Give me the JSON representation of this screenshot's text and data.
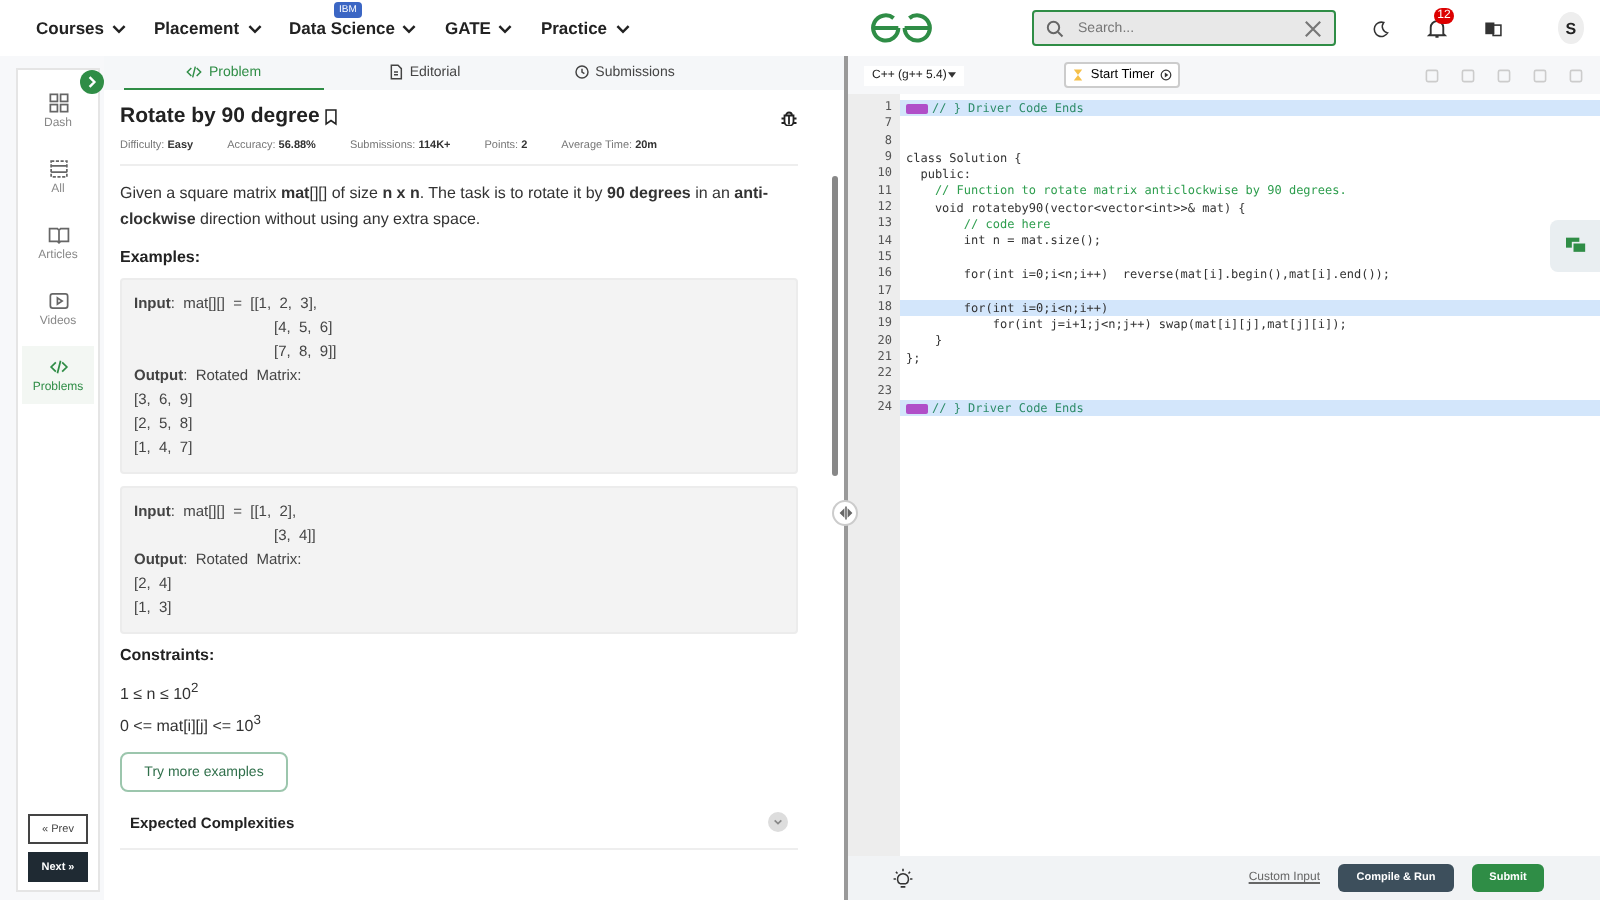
{
  "nav": {
    "items": [
      {
        "label": "Courses"
      },
      {
        "label": "Placement"
      },
      {
        "label": "Data Science",
        "badge": "IBM"
      },
      {
        "label": "GATE"
      },
      {
        "label": "Practice"
      }
    ],
    "search": {
      "placeholder": "Search..."
    },
    "notifications": "12",
    "avatar": "S"
  },
  "sidebar": {
    "items": [
      {
        "label": "Dash",
        "selected": false
      },
      {
        "label": "All",
        "selected": false
      },
      {
        "label": "Articles",
        "selected": false
      },
      {
        "label": "Videos",
        "selected": false
      },
      {
        "label": "Problems",
        "selected": true
      }
    ],
    "prev": "« Prev",
    "next": "Next »"
  },
  "tabs": [
    {
      "label": "Problem",
      "selected": true
    },
    {
      "label": "Editorial",
      "selected": false
    },
    {
      "label": "Submissions",
      "selected": false
    }
  ],
  "problem": {
    "title": "Rotate by 90 degree",
    "stats": [
      "Difficulty: **Easy**",
      "Accuracy: **56.88%**",
      "Submissions: **114K+**",
      "Points: **2**",
      "Average Time: **20m**"
    ],
    "statement": "Given a square matrix **mat**[][] of size **n x n**. The task is to rotate it by **90 degrees** in an **anti-clockwise** direction without using any extra space.",
    "examples_heading": "Examples:",
    "examples": [
      [
        {
          "text": "**Input**:  mat[][]  =  [[1,  2,  3],",
          "kind": "line"
        },
        {
          "text": "[4,  5,  6]",
          "kind": "continuation"
        },
        {
          "text": "[7,  8,  9]]",
          "kind": "continuation"
        },
        {
          "text": "**Output**:  Rotated  Matrix:",
          "kind": "line"
        },
        {
          "text": "[3,  6,  9]",
          "kind": "line"
        },
        {
          "text": "[2,  5,  8]",
          "kind": "line"
        },
        {
          "text": "[1,  4,  7]",
          "kind": "line"
        }
      ],
      [
        {
          "text": "**Input**:  mat[][]  =  [[1,  2],",
          "kind": "line"
        },
        {
          "text": "[3,  4]]",
          "kind": "continuation"
        },
        {
          "text": "**Output**:  Rotated  Matrix:",
          "kind": "line"
        },
        {
          "text": "[2,  4]",
          "kind": "line"
        },
        {
          "text": "[1,  3]",
          "kind": "line"
        }
      ]
    ],
    "constraints_heading": "Constraints:",
    "constraints": [
      "1 ≤ n ≤ 10$^{2}$",
      "0 <= mat[i][j] <= 10$^{3}$"
    ],
    "more_button": "Try more examples",
    "complexities": "Expected Complexities"
  },
  "editor": {
    "language": "C++ (g++ 5.4)",
    "timer": "Start Timer",
    "lines": [
      {
        "num": "1",
        "text": "// } Driver Code Ends",
        "kind": "driver",
        "highlighted": true
      },
      {
        "num": "7",
        "kind": "code",
        "highlighted": false
      },
      {
        "num": "8",
        "kind": "code",
        "highlighted": false
      },
      {
        "num": "9",
        "text": "class Solution {",
        "kind": "code",
        "highlighted": false
      },
      {
        "num": "10",
        "text": "  public:",
        "kind": "code",
        "highlighted": false
      },
      {
        "num": "11",
        "text": "    // Function to rotate matrix anticlockwise by 90 degrees.",
        "kind": "comment",
        "highlighted": false
      },
      {
        "num": "12",
        "text": "    void rotateby90(vector<vector<int>>& mat) {",
        "kind": "code",
        "highlighted": false
      },
      {
        "num": "13",
        "text": "        // code here",
        "kind": "comment",
        "highlighted": false
      },
      {
        "num": "14",
        "text": "        int n = mat.size();",
        "kind": "code",
        "highlighted": false
      },
      {
        "num": "15",
        "kind": "code",
        "highlighted": false
      },
      {
        "num": "16",
        "text": "        for(int i=0;i<n;i++)  reverse(mat[i].begin(),mat[i].end());",
        "kind": "code",
        "highlighted": false
      },
      {
        "num": "17",
        "kind": "code",
        "highlighted": false
      },
      {
        "num": "18",
        "text": "        for(int i=0;i<n;i++)",
        "kind": "code",
        "highlighted": true
      },
      {
        "num": "19",
        "text": "            for(int j=i+1;j<n;j++) swap(mat[i][j],mat[j][i]);",
        "kind": "code",
        "highlighted": false
      },
      {
        "num": "20",
        "text": "    }",
        "kind": "code",
        "highlighted": false
      },
      {
        "num": "21",
        "text": "};",
        "kind": "code",
        "highlighted": false
      },
      {
        "num": "22",
        "kind": "code",
        "highlighted": false
      },
      {
        "num": "23",
        "kind": "code",
        "highlighted": false
      },
      {
        "num": "24",
        "text": "// } Driver Code Ends",
        "kind": "driver",
        "highlighted": true
      }
    ],
    "custom_input": "Custom Input",
    "compile": "Compile & Run",
    "submit": "Submit"
  }
}
